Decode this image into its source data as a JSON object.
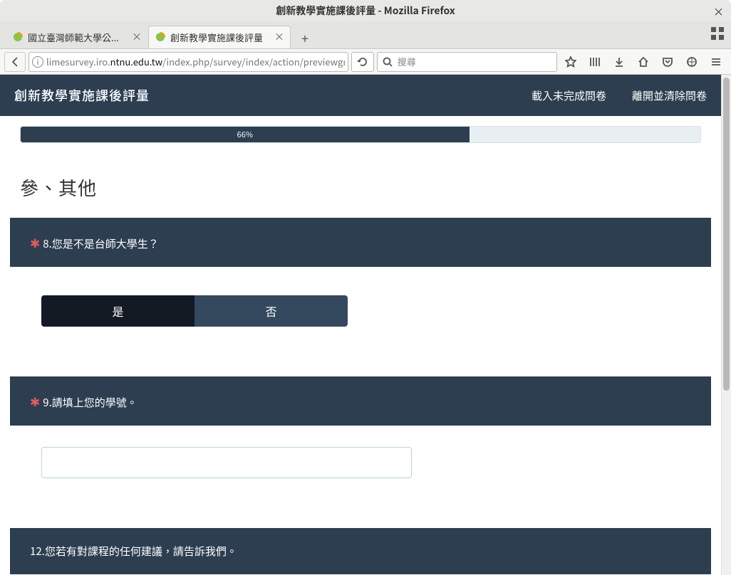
{
  "os": {
    "title": "創新教學實施課後評量 - Mozilla Firefox",
    "close": "×"
  },
  "tabs": [
    {
      "label": "國立臺灣師範大學公..."
    },
    {
      "label": "創新教學實施課後評量"
    }
  ],
  "newtab": "+",
  "url": {
    "prefix": "limesurvey.iro.",
    "domain": "ntnu.edu.tw",
    "suffix": "/index.php/survey/index/action/previewgro"
  },
  "search": {
    "placeholder": "搜尋"
  },
  "survey": {
    "title": "創新教學實施課後評量",
    "load_link": "載入未完成問卷",
    "exit_link": "離開並清除問卷"
  },
  "progress": {
    "percent": "66%",
    "width": "66%"
  },
  "section_title": "參、其他",
  "q8": {
    "required": "✱",
    "text": "8.您是不是台師大學生？",
    "yes": "是",
    "no": "否"
  },
  "q9": {
    "required": "✱",
    "text": "9.請填上您的學號。"
  },
  "q12": {
    "text": "12.您若有對課程的任何建議，請告訴我們。"
  }
}
